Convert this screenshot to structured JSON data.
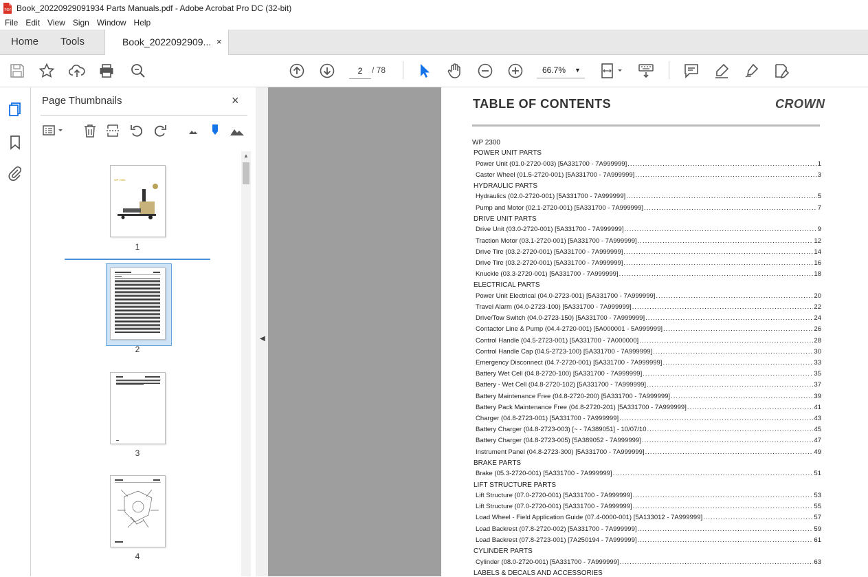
{
  "window": {
    "title": "Book_20220929091934 Parts Manuals.pdf - Adobe Acrobat Pro DC (32-bit)"
  },
  "menu": [
    "File",
    "Edit",
    "View",
    "Sign",
    "Window",
    "Help"
  ],
  "tabs": {
    "home": "Home",
    "tools": "Tools",
    "document": "Book_2022092909...",
    "close": "×"
  },
  "toolbar": {
    "current_page": "2",
    "total_pages": "/ 78",
    "zoom": "66.7%"
  },
  "icons": {
    "save": "save-icon",
    "star": "bookmark-star-icon",
    "upload": "share-upload-icon",
    "print": "print-icon",
    "search": "zoom-search-icon",
    "prev": "page-up-icon",
    "next": "page-down-icon",
    "select": "select-arrow-icon",
    "hand": "hand-icon",
    "zoom_out": "zoom-out-icon",
    "zoom_in": "zoom-in-icon",
    "fit": "fit-page-icon",
    "keyboard": "scroll-mode-icon",
    "comment": "comment-icon",
    "highlight": "highlight-icon",
    "sign": "sign-icon",
    "fill": "fill-sign-icon"
  },
  "panel": {
    "title": "Page Thumbnails",
    "close": "×",
    "thumbnails": [
      {
        "num": "1",
        "label": "WP 2300"
      },
      {
        "num": "2",
        "label": ""
      },
      {
        "num": "3",
        "label": ""
      },
      {
        "num": "4",
        "label": ""
      }
    ]
  },
  "document": {
    "title": "TABLE OF CONTENTS",
    "logo": "CROWN",
    "model": "WP 2300",
    "toc": [
      {
        "section": "POWER UNIT PARTS",
        "entries": [
          {
            "label": "Power Unit (01.0-2720-003)  [5A331700 - 7A999999]",
            "page": "1"
          },
          {
            "label": "Caster Wheel (01.5-2720-001)  [5A331700 - 7A999999]",
            "page": "3"
          }
        ]
      },
      {
        "section": "HYDRAULIC PARTS",
        "entries": [
          {
            "label": "Hydraulics (02.0-2720-001)  [5A331700 - 7A999999]",
            "page": "5"
          },
          {
            "label": "Pump and Motor (02.1-2720-001)  [5A331700 - 7A999999]",
            "page": "7"
          }
        ]
      },
      {
        "section": "DRIVE UNIT PARTS",
        "entries": [
          {
            "label": "Drive Unit (03.0-2720-001)  [5A331700 - 7A999999]",
            "page": "9"
          },
          {
            "label": "Traction Motor (03.1-2720-001)  [5A331700 - 7A999999]",
            "page": "12"
          },
          {
            "label": "Drive Tire (03.2-2720-001)  [5A331700 - 7A999999]",
            "page": "14"
          },
          {
            "label": "Drive Tire (03.2-2720-001)  [5A331700 - 7A999999]",
            "page": "16"
          },
          {
            "label": "Knuckle (03.3-2720-001)  [5A331700 - 7A999999]",
            "page": "18"
          }
        ]
      },
      {
        "section": "ELECTRICAL PARTS",
        "entries": [
          {
            "label": "Power Unit Electrical (04.0-2723-001)  [5A331700 - 7A999999]",
            "page": "20"
          },
          {
            "label": "Travel Alarm (04.0-2723-100)  [5A331700 - 7A999999]",
            "page": "22"
          },
          {
            "label": "Drive/Tow Switch (04.0-2723-150)  [5A331700 - 7A999999]",
            "page": "24"
          },
          {
            "label": "Contactor Line & Pump (04.4-2720-001)  [5A000001 - 5A999999]",
            "page": "26"
          },
          {
            "label": "Control Handle (04.5-2723-001)  [5A331700 - 7A000000]",
            "page": "28"
          },
          {
            "label": "Control Handle Cap (04.5-2723-100)  [5A331700 - 7A999999]",
            "page": "30"
          },
          {
            "label": "Emergency Disconnect (04.7-2720-001)  [5A331700 - 7A999999]",
            "page": "33"
          },
          {
            "label": "Battery Wet Cell (04.8-2720-100)  [5A331700 - 7A999999]",
            "page": "35"
          },
          {
            "label": "Battery - Wet Cell (04.8-2720-102)  [5A331700 - 7A999999]",
            "page": "37"
          },
          {
            "label": "Battery Maintenance Free (04.8-2720-200)  [5A331700 - 7A999999]",
            "page": "39"
          },
          {
            "label": "Battery Pack Maintenance Free (04.8-2720-201)  [5A331700 - 7A999999]",
            "page": "41"
          },
          {
            "label": "Charger (04.8-2723-001)  [5A331700 - 7A999999]",
            "page": "43"
          },
          {
            "label": "Battery Charger (04.8-2723-003)  [~ - 7A389051] - 10/07/10",
            "page": "45"
          },
          {
            "label": "Battery Charger (04.8-2723-005)  [5A389052 - 7A999999]",
            "page": "47"
          },
          {
            "label": "Instrument Panel (04.8-2723-300)  [5A331700 - 7A999999]",
            "page": "49"
          }
        ]
      },
      {
        "section": "BRAKE PARTS",
        "entries": [
          {
            "label": "Brake (05.3-2720-001)  [5A331700 - 7A999999]",
            "page": "51"
          }
        ]
      },
      {
        "section": "LIFT STRUCTURE PARTS",
        "entries": [
          {
            "label": "Lift Structure (07.0-2720-001)  [5A331700 - 7A999999]",
            "page": "53"
          },
          {
            "label": "Lift Structure (07.0-2720-001)  [5A331700 - 7A999999]",
            "page": "55"
          },
          {
            "label": "Load Wheel - Field Application Guide (07.4-0000-001)  [5A133012 - 7A999999]",
            "page": "57"
          },
          {
            "label": "Load Backrest (07.8-2720-002)  [5A331700 - 7A999999]",
            "page": "59"
          },
          {
            "label": "Load Backrest (07.8-2723-001)  [7A250194 - 7A999999]",
            "page": "61"
          }
        ]
      },
      {
        "section": "CYLINDER PARTS",
        "entries": [
          {
            "label": "Cylinder (08.0-2720-001)  [5A331700 - 7A999999]",
            "page": "63"
          }
        ]
      },
      {
        "section": "LABELS & DECALS AND ACCESSORIES",
        "entries": []
      }
    ]
  }
}
